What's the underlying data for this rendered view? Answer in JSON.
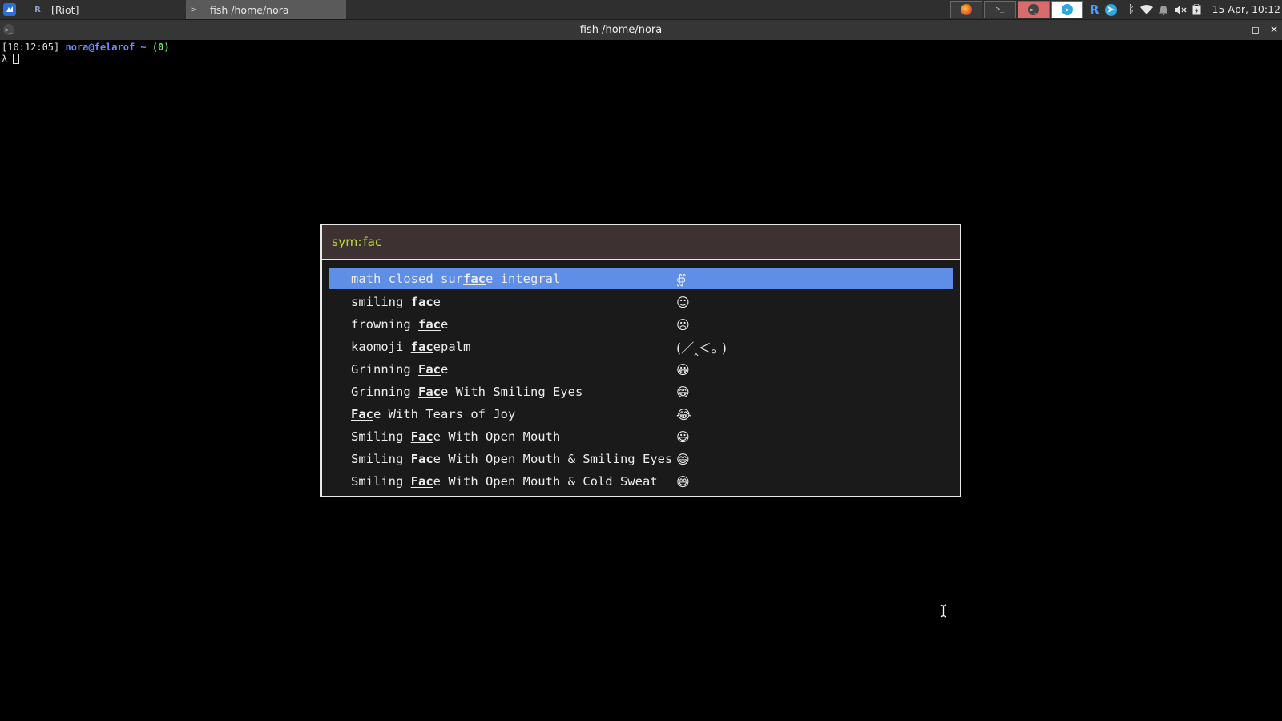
{
  "taskbar": {
    "tasks": [
      {
        "label": "[Riot]",
        "icon": "riot-icon"
      },
      {
        "label": "fish  /home/nora",
        "icon": "terminal-icon"
      }
    ],
    "tray_apps": [
      "firefox-icon",
      "terminal-icon",
      "terminal-icon",
      "telegram-icon"
    ],
    "sys_icons": [
      "riot-tray-icon",
      "telegram-tray-icon",
      "bluetooth-icon",
      "wifi-icon",
      "notification-bell-icon",
      "volume-muted-icon",
      "clipboard-icon"
    ],
    "clock": "15 Apr, 10:12"
  },
  "window": {
    "title": "fish  /home/nora",
    "controls": {
      "minimize": "–",
      "maximize": "◻",
      "close": "✕"
    }
  },
  "terminal": {
    "time": "[10:12:05]",
    "user": "nora@felarof",
    "path": "~",
    "status": "(0)",
    "prompt": "λ"
  },
  "launcher": {
    "prompt": "sym:",
    "query": "fac",
    "items": [
      {
        "pre": "math closed sur",
        "match": "fac",
        "post": "e integral",
        "symbol": "∯",
        "selected": true
      },
      {
        "pre": "smiling ",
        "match": "fac",
        "post": "e",
        "symbol": "☺",
        "selected": false
      },
      {
        "pre": "frowning ",
        "match": "fac",
        "post": "e",
        "symbol": "☹",
        "selected": false
      },
      {
        "pre": "kaomoji ",
        "match": "fac",
        "post": "epalm",
        "symbol": "(／‸＜｡ )",
        "selected": false
      },
      {
        "pre": "Grinning ",
        "match": "Fac",
        "post": "e",
        "symbol": "😀",
        "selected": false
      },
      {
        "pre": "Grinning ",
        "match": "Fac",
        "post": "e With Smiling Eyes",
        "symbol": "😁",
        "selected": false
      },
      {
        "pre": "",
        "match": "Fac",
        "post": "e With Tears of Joy",
        "symbol": "😂",
        "selected": false
      },
      {
        "pre": "Smiling ",
        "match": "Fac",
        "post": "e With Open Mouth",
        "symbol": "😃",
        "selected": false
      },
      {
        "pre": "Smiling ",
        "match": "Fac",
        "post": "e With Open Mouth & Smiling Eyes",
        "symbol": "😄",
        "selected": false
      },
      {
        "pre": "Smiling ",
        "match": "Fac",
        "post": "e With Open Mouth & Cold Sweat",
        "symbol": "😅",
        "selected": false
      }
    ]
  }
}
